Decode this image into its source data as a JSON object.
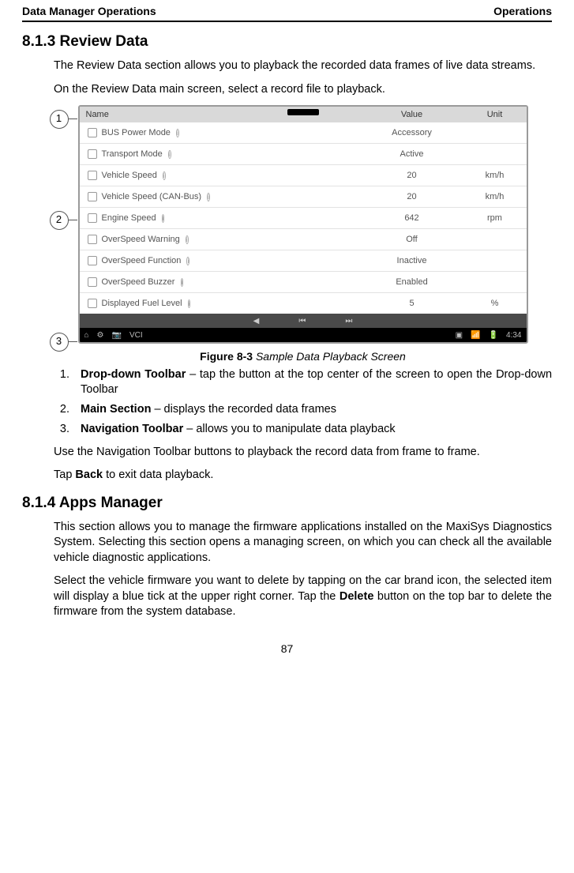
{
  "header": {
    "left": "Data Manager Operations",
    "right": "Operations"
  },
  "sec1": {
    "num_title": "8.1.3   Review Data",
    "p1": "The Review Data section allows you to playback the recorded data frames of live data streams.",
    "p2": "On the Review Data main screen, select a record file to playback."
  },
  "figure": {
    "callouts": [
      "1",
      "2",
      "3"
    ],
    "head": {
      "name": "Name",
      "value": "Value",
      "unit": "Unit"
    },
    "rows": [
      {
        "name": "BUS Power Mode",
        "value": "Accessory",
        "unit": ""
      },
      {
        "name": "Transport Mode",
        "value": "Active",
        "unit": ""
      },
      {
        "name": "Vehicle Speed",
        "value": "20",
        "unit": "km/h"
      },
      {
        "name": "Vehicle Speed (CAN-Bus)",
        "value": "20",
        "unit": "km/h"
      },
      {
        "name": "Engine Speed",
        "value": "642",
        "unit": "rpm"
      },
      {
        "name": "OverSpeed Warning",
        "value": "Off",
        "unit": ""
      },
      {
        "name": "OverSpeed Function",
        "value": "Inactive",
        "unit": ""
      },
      {
        "name": "OverSpeed Buzzer",
        "value": "Enabled",
        "unit": ""
      },
      {
        "name": "Displayed Fuel Level",
        "value": "5",
        "unit": "%"
      }
    ],
    "status_time": "4:34",
    "caption_label": "Figure 8-3",
    "caption_text": " Sample Data Playback Screen"
  },
  "legend": {
    "i1_b": "Drop-down Toolbar",
    "i1_t": " – tap the button at the top center of the screen to open the Drop-down Toolbar",
    "i2_b": "Main Section",
    "i2_t": " – displays the recorded data frames",
    "i3_b": "Navigation Toolbar",
    "i3_t": " – allows you to manipulate data playback"
  },
  "after": {
    "p1": "Use the Navigation Toolbar buttons to playback the record data from frame to frame.",
    "p2a": "Tap ",
    "p2b": "Back",
    "p2c": " to exit data playback."
  },
  "sec2": {
    "num_title": "8.1.4   Apps Manager",
    "p1": "This section allows you to manage the firmware applications installed on the MaxiSys Diagnostics System. Selecting this section opens a managing screen, on which you can check all the available vehicle diagnostic applications.",
    "p2a": "Select the vehicle firmware you want to delete by tapping on the car brand icon, the selected item will display a blue tick at the upper right corner. Tap the ",
    "p2b": "Delete",
    "p2c": " button on the top bar to delete the firmware from the system database."
  },
  "pagenum": "87"
}
